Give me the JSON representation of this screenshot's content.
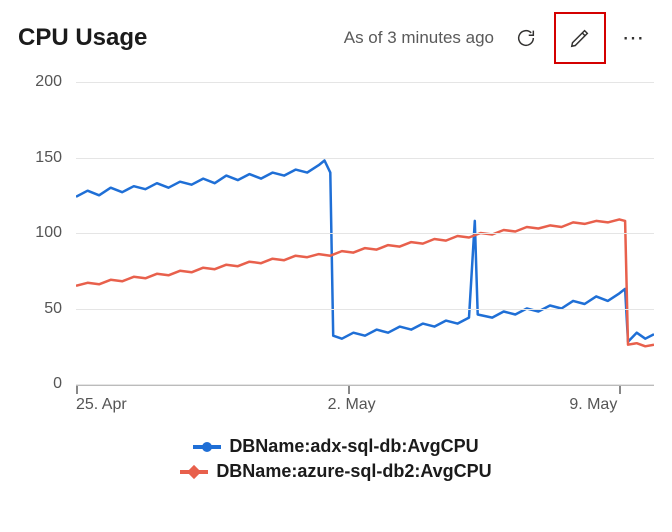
{
  "header": {
    "title": "CPU Usage",
    "as_of": "As of 3 minutes ago"
  },
  "chart_data": {
    "type": "line",
    "ylabel": "",
    "xlabel": "",
    "ylim": [
      0,
      200
    ],
    "y_ticks": [
      0,
      50,
      100,
      150,
      200
    ],
    "x_ticks": [
      {
        "label": "25. Apr",
        "pos": 0.0
      },
      {
        "label": "2. May",
        "pos": 0.47
      },
      {
        "label": "9. May",
        "pos": 0.94
      }
    ],
    "series": [
      {
        "name": "DBName:adx-sql-db:AvgCPU",
        "color": "#1f6fd6",
        "marker": "round",
        "values": [
          {
            "x": 0.0,
            "y": 124
          },
          {
            "x": 0.02,
            "y": 128
          },
          {
            "x": 0.04,
            "y": 125
          },
          {
            "x": 0.06,
            "y": 130
          },
          {
            "x": 0.08,
            "y": 127
          },
          {
            "x": 0.1,
            "y": 131
          },
          {
            "x": 0.12,
            "y": 129
          },
          {
            "x": 0.14,
            "y": 133
          },
          {
            "x": 0.16,
            "y": 130
          },
          {
            "x": 0.18,
            "y": 134
          },
          {
            "x": 0.2,
            "y": 132
          },
          {
            "x": 0.22,
            "y": 136
          },
          {
            "x": 0.24,
            "y": 133
          },
          {
            "x": 0.26,
            "y": 138
          },
          {
            "x": 0.28,
            "y": 135
          },
          {
            "x": 0.3,
            "y": 139
          },
          {
            "x": 0.32,
            "y": 136
          },
          {
            "x": 0.34,
            "y": 140
          },
          {
            "x": 0.36,
            "y": 138
          },
          {
            "x": 0.38,
            "y": 142
          },
          {
            "x": 0.4,
            "y": 140
          },
          {
            "x": 0.42,
            "y": 145
          },
          {
            "x": 0.43,
            "y": 148
          },
          {
            "x": 0.44,
            "y": 140
          },
          {
            "x": 0.445,
            "y": 32
          },
          {
            "x": 0.46,
            "y": 30
          },
          {
            "x": 0.48,
            "y": 34
          },
          {
            "x": 0.5,
            "y": 32
          },
          {
            "x": 0.52,
            "y": 36
          },
          {
            "x": 0.54,
            "y": 34
          },
          {
            "x": 0.56,
            "y": 38
          },
          {
            "x": 0.58,
            "y": 36
          },
          {
            "x": 0.6,
            "y": 40
          },
          {
            "x": 0.62,
            "y": 38
          },
          {
            "x": 0.64,
            "y": 42
          },
          {
            "x": 0.66,
            "y": 40
          },
          {
            "x": 0.68,
            "y": 44
          },
          {
            "x": 0.69,
            "y": 108
          },
          {
            "x": 0.695,
            "y": 46
          },
          {
            "x": 0.72,
            "y": 44
          },
          {
            "x": 0.74,
            "y": 48
          },
          {
            "x": 0.76,
            "y": 46
          },
          {
            "x": 0.78,
            "y": 50
          },
          {
            "x": 0.8,
            "y": 48
          },
          {
            "x": 0.82,
            "y": 52
          },
          {
            "x": 0.84,
            "y": 50
          },
          {
            "x": 0.86,
            "y": 55
          },
          {
            "x": 0.88,
            "y": 53
          },
          {
            "x": 0.9,
            "y": 58
          },
          {
            "x": 0.92,
            "y": 55
          },
          {
            "x": 0.94,
            "y": 60
          },
          {
            "x": 0.95,
            "y": 63
          },
          {
            "x": 0.955,
            "y": 28
          },
          {
            "x": 0.97,
            "y": 34
          },
          {
            "x": 0.985,
            "y": 30
          },
          {
            "x": 1.0,
            "y": 33
          }
        ]
      },
      {
        "name": "DBName:azure-sql-db2:AvgCPU",
        "color": "#e8604c",
        "marker": "diamond",
        "values": [
          {
            "x": 0.0,
            "y": 65
          },
          {
            "x": 0.02,
            "y": 67
          },
          {
            "x": 0.04,
            "y": 66
          },
          {
            "x": 0.06,
            "y": 69
          },
          {
            "x": 0.08,
            "y": 68
          },
          {
            "x": 0.1,
            "y": 71
          },
          {
            "x": 0.12,
            "y": 70
          },
          {
            "x": 0.14,
            "y": 73
          },
          {
            "x": 0.16,
            "y": 72
          },
          {
            "x": 0.18,
            "y": 75
          },
          {
            "x": 0.2,
            "y": 74
          },
          {
            "x": 0.22,
            "y": 77
          },
          {
            "x": 0.24,
            "y": 76
          },
          {
            "x": 0.26,
            "y": 79
          },
          {
            "x": 0.28,
            "y": 78
          },
          {
            "x": 0.3,
            "y": 81
          },
          {
            "x": 0.32,
            "y": 80
          },
          {
            "x": 0.34,
            "y": 83
          },
          {
            "x": 0.36,
            "y": 82
          },
          {
            "x": 0.38,
            "y": 85
          },
          {
            "x": 0.4,
            "y": 84
          },
          {
            "x": 0.42,
            "y": 86
          },
          {
            "x": 0.44,
            "y": 85
          },
          {
            "x": 0.46,
            "y": 88
          },
          {
            "x": 0.48,
            "y": 87
          },
          {
            "x": 0.5,
            "y": 90
          },
          {
            "x": 0.52,
            "y": 89
          },
          {
            "x": 0.54,
            "y": 92
          },
          {
            "x": 0.56,
            "y": 91
          },
          {
            "x": 0.58,
            "y": 94
          },
          {
            "x": 0.6,
            "y": 93
          },
          {
            "x": 0.62,
            "y": 96
          },
          {
            "x": 0.64,
            "y": 95
          },
          {
            "x": 0.66,
            "y": 98
          },
          {
            "x": 0.68,
            "y": 97
          },
          {
            "x": 0.7,
            "y": 100
          },
          {
            "x": 0.72,
            "y": 99
          },
          {
            "x": 0.74,
            "y": 102
          },
          {
            "x": 0.76,
            "y": 101
          },
          {
            "x": 0.78,
            "y": 104
          },
          {
            "x": 0.8,
            "y": 103
          },
          {
            "x": 0.82,
            "y": 105
          },
          {
            "x": 0.84,
            "y": 104
          },
          {
            "x": 0.86,
            "y": 107
          },
          {
            "x": 0.88,
            "y": 106
          },
          {
            "x": 0.9,
            "y": 108
          },
          {
            "x": 0.92,
            "y": 107
          },
          {
            "x": 0.94,
            "y": 109
          },
          {
            "x": 0.95,
            "y": 108
          },
          {
            "x": 0.955,
            "y": 26
          },
          {
            "x": 0.97,
            "y": 27
          },
          {
            "x": 0.985,
            "y": 25
          },
          {
            "x": 1.0,
            "y": 26
          }
        ]
      }
    ]
  }
}
